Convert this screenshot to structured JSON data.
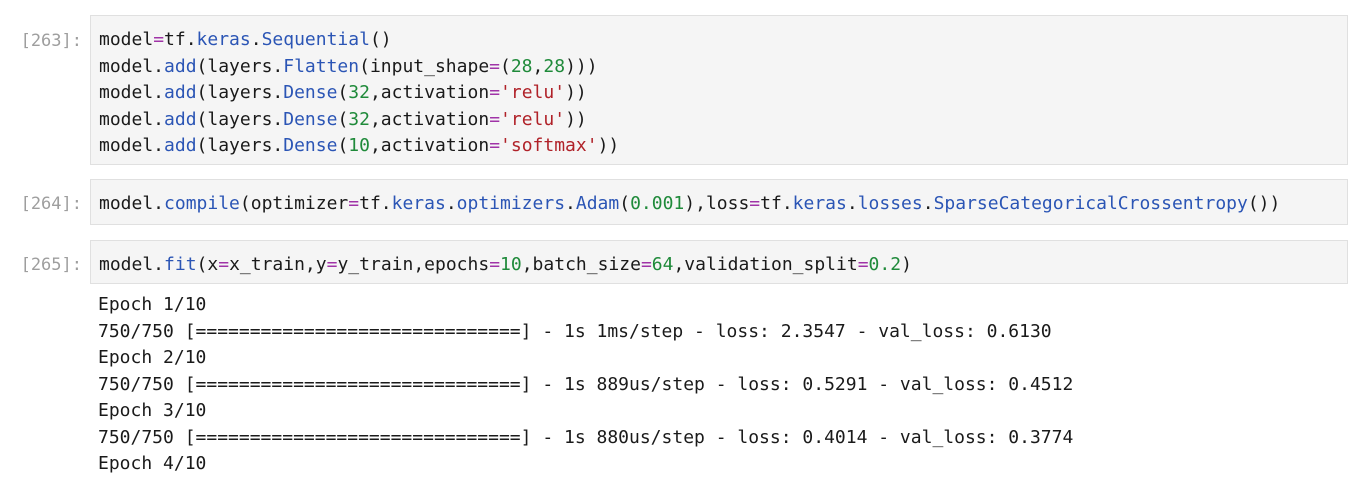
{
  "cells": [
    {
      "prompt": "[263]:",
      "lines": [
        [
          {
            "t": "model",
            "c": "txt"
          },
          {
            "t": "=",
            "c": "op"
          },
          {
            "t": "tf.",
            "c": "txt"
          },
          {
            "t": "keras",
            "c": "attr"
          },
          {
            "t": ".",
            "c": "txt"
          },
          {
            "t": "Sequential",
            "c": "attr"
          },
          {
            "t": "()",
            "c": "txt"
          }
        ],
        [
          {
            "t": "model.",
            "c": "txt"
          },
          {
            "t": "add",
            "c": "attr"
          },
          {
            "t": "(layers.",
            "c": "txt"
          },
          {
            "t": "Flatten",
            "c": "attr"
          },
          {
            "t": "(input_shape",
            "c": "txt"
          },
          {
            "t": "=",
            "c": "op"
          },
          {
            "t": "(",
            "c": "txt"
          },
          {
            "t": "28",
            "c": "num"
          },
          {
            "t": ",",
            "c": "txt"
          },
          {
            "t": "28",
            "c": "num"
          },
          {
            "t": ")))",
            "c": "txt"
          }
        ],
        [
          {
            "t": "model.",
            "c": "txt"
          },
          {
            "t": "add",
            "c": "attr"
          },
          {
            "t": "(layers.",
            "c": "txt"
          },
          {
            "t": "Dense",
            "c": "attr"
          },
          {
            "t": "(",
            "c": "txt"
          },
          {
            "t": "32",
            "c": "num"
          },
          {
            "t": ",activation",
            "c": "txt"
          },
          {
            "t": "=",
            "c": "op"
          },
          {
            "t": "'relu'",
            "c": "str"
          },
          {
            "t": "))",
            "c": "txt"
          }
        ],
        [
          {
            "t": "model.",
            "c": "txt"
          },
          {
            "t": "add",
            "c": "attr"
          },
          {
            "t": "(layers.",
            "c": "txt"
          },
          {
            "t": "Dense",
            "c": "attr"
          },
          {
            "t": "(",
            "c": "txt"
          },
          {
            "t": "32",
            "c": "num"
          },
          {
            "t": ",activation",
            "c": "txt"
          },
          {
            "t": "=",
            "c": "op"
          },
          {
            "t": "'relu'",
            "c": "str"
          },
          {
            "t": "))",
            "c": "txt"
          }
        ],
        [
          {
            "t": "model.",
            "c": "txt"
          },
          {
            "t": "add",
            "c": "attr"
          },
          {
            "t": "(layers.",
            "c": "txt"
          },
          {
            "t": "Dense",
            "c": "attr"
          },
          {
            "t": "(",
            "c": "txt"
          },
          {
            "t": "10",
            "c": "num"
          },
          {
            "t": ",activation",
            "c": "txt"
          },
          {
            "t": "=",
            "c": "op"
          },
          {
            "t": "'softmax'",
            "c": "str"
          },
          {
            "t": "))",
            "c": "txt"
          }
        ]
      ]
    },
    {
      "prompt": "[264]:",
      "lines": [
        [
          {
            "t": "model.",
            "c": "txt"
          },
          {
            "t": "compile",
            "c": "attr"
          },
          {
            "t": "(optimizer",
            "c": "txt"
          },
          {
            "t": "=",
            "c": "op"
          },
          {
            "t": "tf.",
            "c": "txt"
          },
          {
            "t": "keras",
            "c": "attr"
          },
          {
            "t": ".",
            "c": "txt"
          },
          {
            "t": "optimizers",
            "c": "attr"
          },
          {
            "t": ".",
            "c": "txt"
          },
          {
            "t": "Adam",
            "c": "attr"
          },
          {
            "t": "(",
            "c": "txt"
          },
          {
            "t": "0.001",
            "c": "num"
          },
          {
            "t": "),loss",
            "c": "txt"
          },
          {
            "t": "=",
            "c": "op"
          },
          {
            "t": "tf.",
            "c": "txt"
          },
          {
            "t": "keras",
            "c": "attr"
          },
          {
            "t": ".",
            "c": "txt"
          },
          {
            "t": "losses",
            "c": "attr"
          },
          {
            "t": ".",
            "c": "txt"
          },
          {
            "t": "SparseCategoricalCrossentropy",
            "c": "attr"
          },
          {
            "t": "())",
            "c": "txt"
          }
        ]
      ]
    },
    {
      "prompt": "[265]:",
      "lines": [
        [
          {
            "t": "model.",
            "c": "txt"
          },
          {
            "t": "fit",
            "c": "attr"
          },
          {
            "t": "(x",
            "c": "txt"
          },
          {
            "t": "=",
            "c": "op"
          },
          {
            "t": "x_train,y",
            "c": "txt"
          },
          {
            "t": "=",
            "c": "op"
          },
          {
            "t": "y_train,epochs",
            "c": "txt"
          },
          {
            "t": "=",
            "c": "op"
          },
          {
            "t": "10",
            "c": "num"
          },
          {
            "t": ",batch_size",
            "c": "txt"
          },
          {
            "t": "=",
            "c": "op"
          },
          {
            "t": "64",
            "c": "num"
          },
          {
            "t": ",validation_split",
            "c": "txt"
          },
          {
            "t": "=",
            "c": "op"
          },
          {
            "t": "0.2",
            "c": "num"
          },
          {
            "t": ")",
            "c": "txt"
          }
        ]
      ]
    }
  ],
  "output": [
    "Epoch 1/10",
    "750/750 [==============================] - 1s 1ms/step - loss: 2.3547 - val_loss: 0.6130",
    "Epoch 2/10",
    "750/750 [==============================] - 1s 889us/step - loss: 0.5291 - val_loss: 0.4512",
    "Epoch 3/10",
    "750/750 [==============================] - 1s 880us/step - loss: 0.4014 - val_loss: 0.3774",
    "Epoch 4/10"
  ]
}
